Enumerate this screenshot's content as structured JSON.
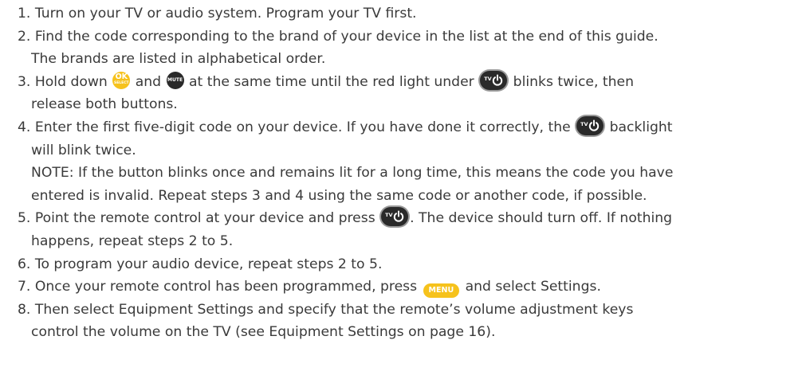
{
  "buttons": {
    "ok_label": "OK",
    "ok_sub": "SELECT",
    "mute_label": "MUTE",
    "tv_label": "TV",
    "menu_label": "MENU"
  },
  "steps": [
    {
      "l1": "1. Turn on your TV or audio system. Program your TV first."
    },
    {
      "l1": "2. Find the code corresponding to the brand of your device in the list at the end of this guide.",
      "l2": "The brands are listed in alphabetical order."
    },
    {
      "a": "3. Hold down ",
      "b": " and ",
      "c": " at the same time until the red light under ",
      "d": " blinks twice, then",
      "l2": "release both buttons."
    },
    {
      "a": "4. Enter the first five-digit code on your device. If you have done it correctly, the ",
      "b": " backlight",
      "l2": "will blink twice.",
      "note1": "NOTE: If the button blinks once and remains lit for a long time, this means the code you have",
      "note2": "entered is invalid. Repeat steps 3 and 4 using the same code or another code, if possible."
    },
    {
      "a": "5. Point the remote control at your device and press ",
      "b": ". The device should turn off. If nothing",
      "l2": "happens, repeat steps 2 to 5."
    },
    {
      "l1": "6. To program your audio device, repeat steps 2 to 5."
    },
    {
      "a": "7. Once your remote control has been programmed, press ",
      "b": " and select Settings."
    },
    {
      "l1": "8. Then select Equipment Settings and specify that the remote’s volume adjustment keys",
      "l2": "control the volume on the TV (see Equipment Settings on page 16)."
    }
  ],
  "colors": {
    "text": "#3a3a3a",
    "ok_yellow": "#f6c21c",
    "button_dark": "#2a2a2a"
  },
  "icons": [
    "ok-select-button-icon",
    "mute-button-icon",
    "tv-power-button-icon",
    "menu-button-icon"
  ]
}
